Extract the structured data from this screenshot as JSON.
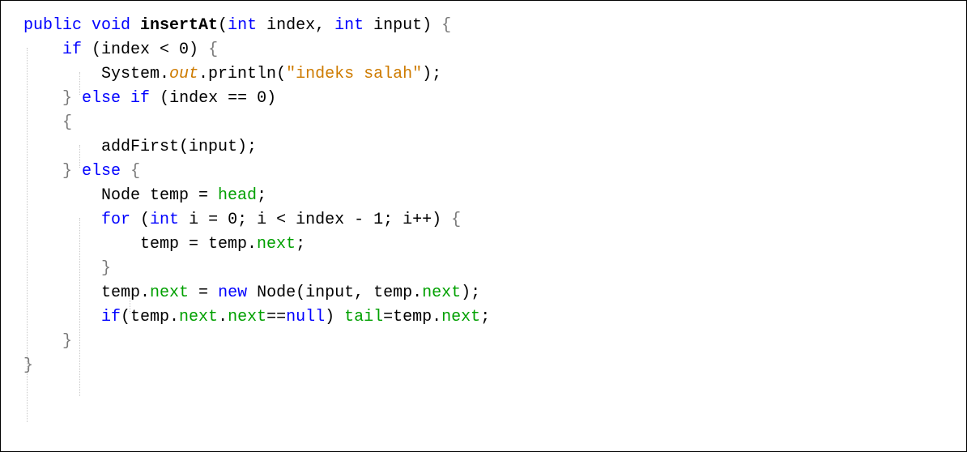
{
  "code_view": {
    "lines": [
      [
        {
          "t": "public void ",
          "c": "kw"
        },
        {
          "t": "insertAt",
          "c": "fn"
        },
        {
          "t": "(",
          "c": ""
        },
        {
          "t": "int",
          "c": "kw"
        },
        {
          "t": " index, ",
          "c": ""
        },
        {
          "t": "int",
          "c": "kw"
        },
        {
          "t": " input) ",
          "c": ""
        },
        {
          "t": "{",
          "c": "br"
        }
      ],
      [
        {
          "t": "    ",
          "c": ""
        },
        {
          "t": "if",
          "c": "kw"
        },
        {
          "t": " (index < 0) ",
          "c": ""
        },
        {
          "t": "{",
          "c": "br"
        }
      ],
      [
        {
          "t": "        System.",
          "c": ""
        },
        {
          "t": "out",
          "c": "it"
        },
        {
          "t": ".println(",
          "c": ""
        },
        {
          "t": "\"indeks salah\"",
          "c": "str"
        },
        {
          "t": ");",
          "c": ""
        }
      ],
      [
        {
          "t": "    ",
          "c": ""
        },
        {
          "t": "}",
          "c": "br"
        },
        {
          "t": " ",
          "c": ""
        },
        {
          "t": "else if",
          "c": "kw"
        },
        {
          "t": " (index == 0)",
          "c": ""
        }
      ],
      [
        {
          "t": "    ",
          "c": ""
        },
        {
          "t": "{",
          "c": "br"
        }
      ],
      [
        {
          "t": "        addFirst(input);",
          "c": ""
        }
      ],
      [
        {
          "t": "    ",
          "c": ""
        },
        {
          "t": "}",
          "c": "br"
        },
        {
          "t": " ",
          "c": ""
        },
        {
          "t": "else",
          "c": "kw"
        },
        {
          "t": " ",
          "c": ""
        },
        {
          "t": "{",
          "c": "br"
        }
      ],
      [
        {
          "t": "        Node temp = ",
          "c": ""
        },
        {
          "t": "head",
          "c": "fld"
        },
        {
          "t": ";",
          "c": ""
        }
      ],
      [
        {
          "t": "        ",
          "c": ""
        },
        {
          "t": "for",
          "c": "kw"
        },
        {
          "t": " (",
          "c": ""
        },
        {
          "t": "int",
          "c": "kw"
        },
        {
          "t": " i = 0; i < index - 1; i++) ",
          "c": ""
        },
        {
          "t": "{",
          "c": "br"
        }
      ],
      [
        {
          "t": "            temp = temp.",
          "c": ""
        },
        {
          "t": "next",
          "c": "fld"
        },
        {
          "t": ";",
          "c": ""
        }
      ],
      [
        {
          "t": "        ",
          "c": ""
        },
        {
          "t": "}",
          "c": "br"
        }
      ],
      [
        {
          "t": "        temp.",
          "c": ""
        },
        {
          "t": "next",
          "c": "fld"
        },
        {
          "t": " = ",
          "c": ""
        },
        {
          "t": "new",
          "c": "kw"
        },
        {
          "t": " Node(input, temp.",
          "c": ""
        },
        {
          "t": "next",
          "c": "fld"
        },
        {
          "t": ");",
          "c": ""
        }
      ],
      [
        {
          "t": "        ",
          "c": ""
        },
        {
          "t": "if",
          "c": "kw"
        },
        {
          "t": "(temp.",
          "c": ""
        },
        {
          "t": "next",
          "c": "fld"
        },
        {
          "t": ".",
          "c": ""
        },
        {
          "t": "next",
          "c": "fld"
        },
        {
          "t": "==",
          "c": ""
        },
        {
          "t": "null",
          "c": "kw"
        },
        {
          "t": ") ",
          "c": ""
        },
        {
          "t": "tail",
          "c": "fld"
        },
        {
          "t": "=temp.",
          "c": ""
        },
        {
          "t": "next",
          "c": "fld"
        },
        {
          "t": ";",
          "c": ""
        }
      ],
      [
        {
          "t": "    ",
          "c": ""
        },
        {
          "t": "}",
          "c": "br"
        }
      ],
      [
        {
          "t": "}",
          "c": "br"
        }
      ]
    ]
  }
}
